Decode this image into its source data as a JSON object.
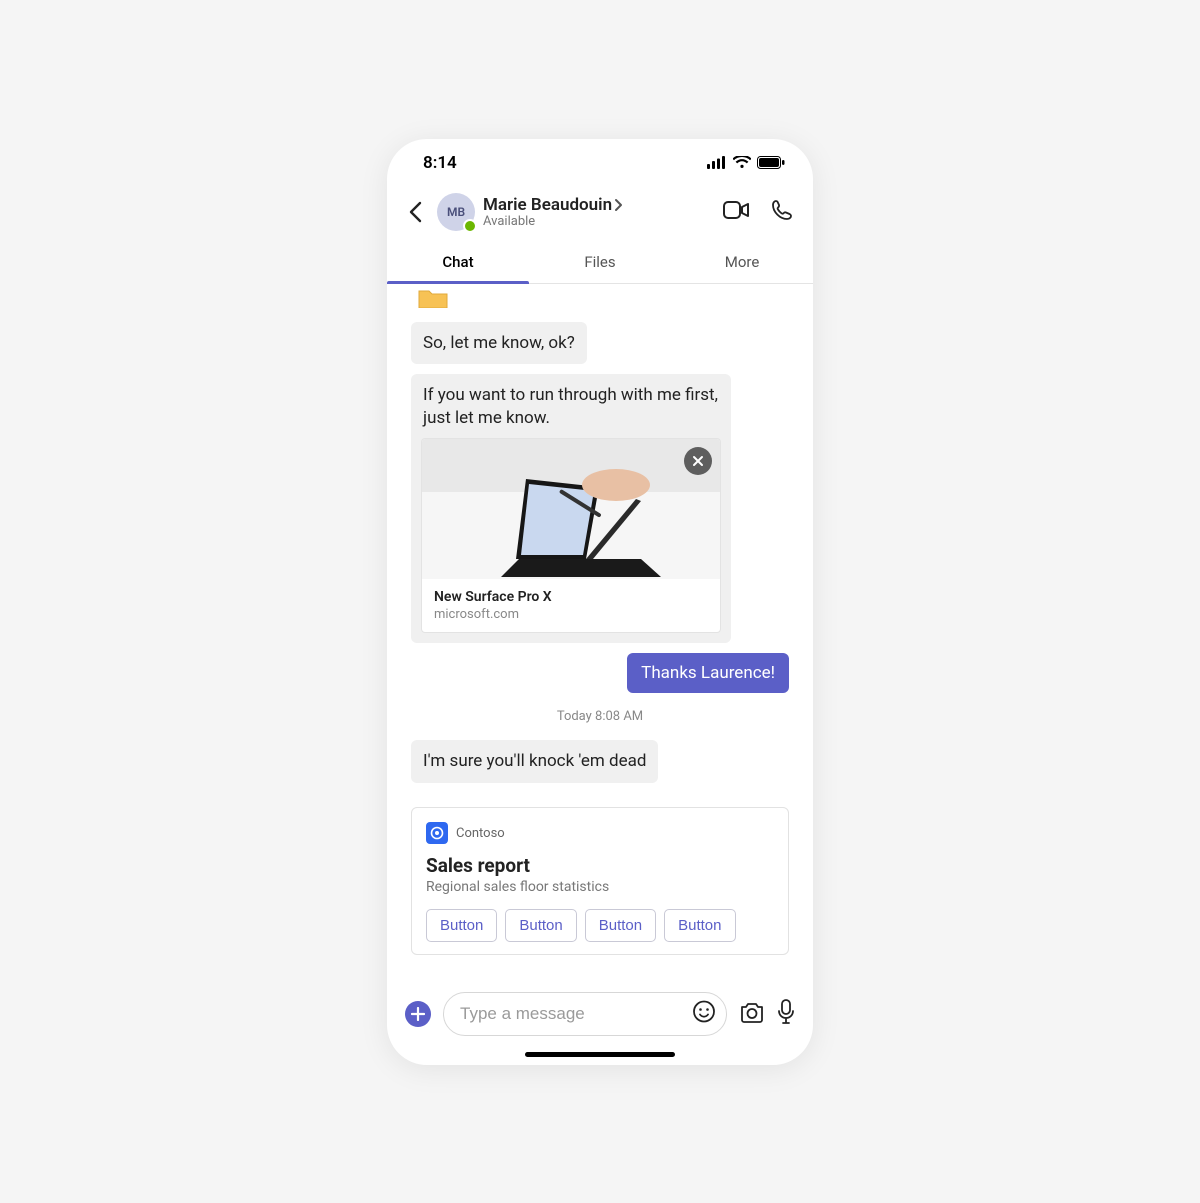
{
  "status": {
    "time": "8:14"
  },
  "header": {
    "avatar_initials": "MB",
    "name": "Marie Beaudouin",
    "presence": "Available"
  },
  "tabs": {
    "chat": "Chat",
    "files": "Files",
    "more": "More"
  },
  "messages": {
    "m1": "So, let me know, ok?",
    "m2": "If you want to run through with me first, just let me know.",
    "link_title": "New Surface Pro X",
    "link_source": "microsoft.com",
    "out1": "Thanks Laurence!",
    "ts": "Today 8:08 AM",
    "m3": "I'm sure you'll knock 'em dead"
  },
  "card": {
    "app": "Contoso",
    "title": "Sales report",
    "subtitle": "Regional sales floor statistics",
    "buttons": [
      "Button",
      "Button",
      "Button",
      "Button"
    ]
  },
  "compose": {
    "placeholder": "Type a message"
  }
}
